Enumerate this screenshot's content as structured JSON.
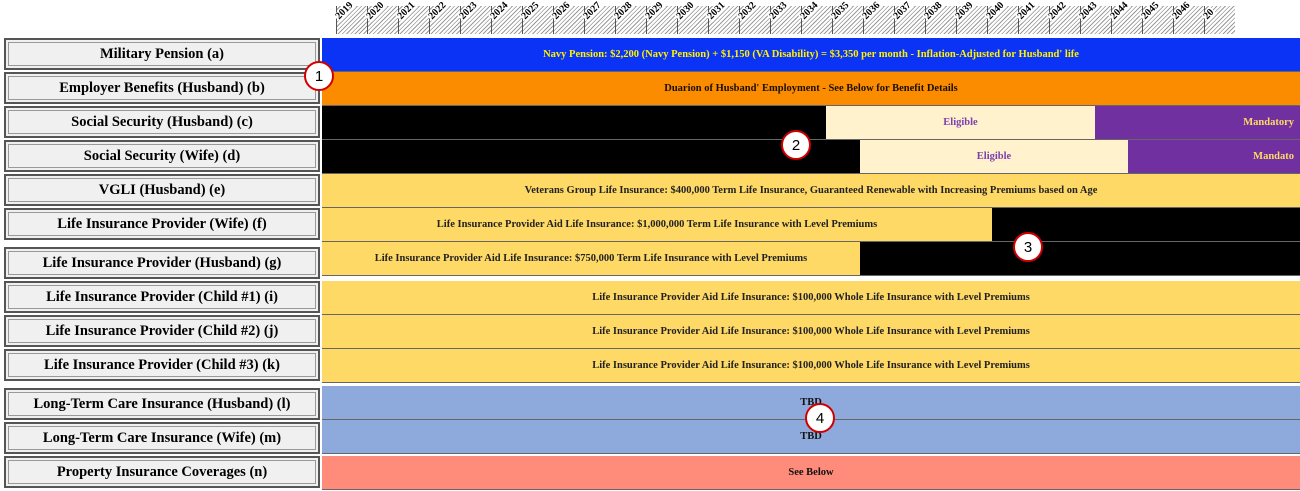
{
  "years": [
    "2019",
    "2020",
    "2021",
    "2022",
    "2023",
    "2024",
    "2025",
    "2026",
    "2027",
    "2028",
    "2029",
    "2030",
    "2031",
    "2032",
    "2033",
    "2034",
    "2035",
    "2036",
    "2037",
    "2038",
    "2039",
    "2040",
    "2041",
    "2042",
    "2043",
    "2044",
    "2045",
    "2046",
    "20"
  ],
  "rows": [
    {
      "label": "Military Pension (a)"
    },
    {
      "label": "Employer Benefits (Husband) (b)"
    },
    {
      "label": "Social Security (Husband)  (c)"
    },
    {
      "label": "Social Security (Wife)  (d)"
    },
    {
      "label": "VGLI (Husband) (e)"
    },
    {
      "label": "Life Insurance Provider (Wife) (f)"
    },
    {
      "label": "Life Insurance Provider (Husband) (g)"
    },
    {
      "label": "Life Insurance Provider (Child #1) (i)"
    },
    {
      "label": "Life Insurance Provider (Child #2) (j)"
    },
    {
      "label": "Life Insurance Provider (Child #3) (k)"
    },
    {
      "label": "Long-Term Care Insurance (Husband) (l)"
    },
    {
      "label": "Long-Term Care Insurance (Wife) (m)"
    },
    {
      "label": "Property Insurance Coverages (n)"
    }
  ],
  "bars": {
    "a_text": "Navy Pension:  $2,200 (Navy Pension) + $1,150 (VA Disability) = $3,350 per month - Inflation-Adjusted for Husband' life",
    "b_text": "Duarion of Husband' Employment - See Below for Benefit Details",
    "c_eligible": "Eligible",
    "c_mandatory": "Mandatory",
    "d_eligible": "Eligible",
    "d_mandatory": "Mandato",
    "e_text": "Veterans Group Life Insurance:  $400,000 Term Life Insurance, Guaranteed Renewable with Increasing Premiums based on Age",
    "f_text": "Life Insurance Provider Aid Life Insurance:  $1,000,000 Term Life Insurance with Level Premiums",
    "g_text": "Life Insurance Provider Aid Life Insurance:  $750,000 Term Life Insurance with Level Premiums",
    "i_text": "Life Insurance Provider Aid Life Insurance:  $100,000 Whole Life Insurance with Level Premiums",
    "j_text": "Life Insurance Provider Aid Life Insurance:  $100,000 Whole Life Insurance with Level Premiums",
    "k_text": "Life Insurance Provider Aid Life Insurance:  $100,000 Whole Life Insurance with Level Premiums",
    "l_text": "TBD",
    "m_text": "TBD",
    "n_text": "See Below"
  },
  "markers": [
    "1",
    "2",
    "3",
    "4"
  ],
  "colors": {
    "blue": "#0b33f5",
    "orange": "#fb8c00",
    "black": "#000000",
    "cream": "#fff2cc",
    "purple": "#7030a0",
    "gold": "#ffd966",
    "steel": "#8ea9db",
    "salmon": "#ff8c7a",
    "marker_border": "#d00000"
  }
}
